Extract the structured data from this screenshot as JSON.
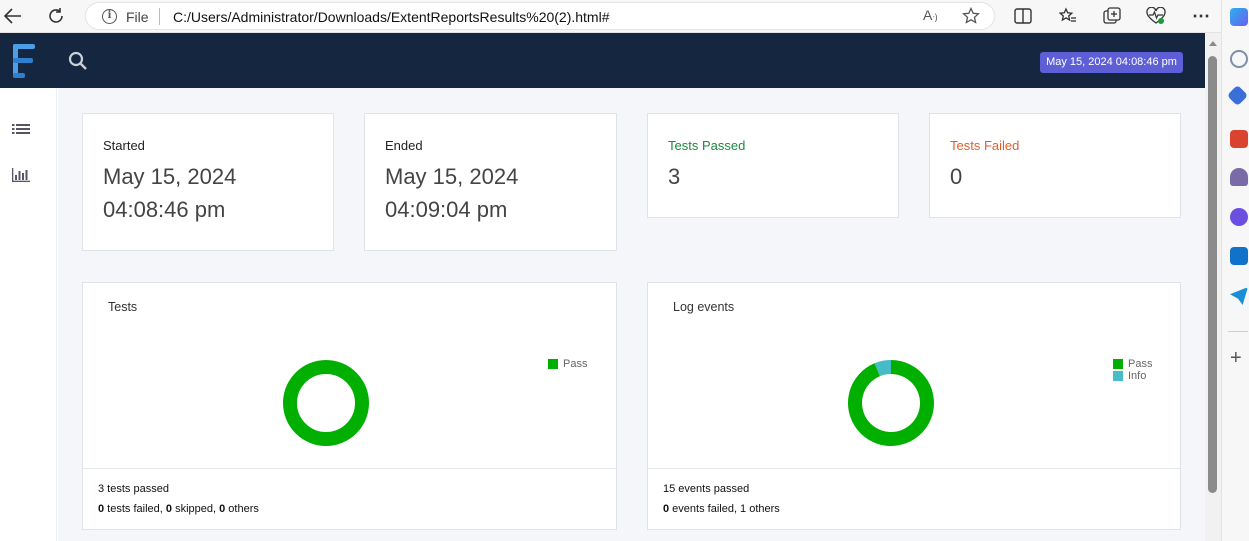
{
  "browser": {
    "file_label": "File",
    "url": "C:/Users/Administrator/Downloads/ExtentReportsResults%20(2).html#"
  },
  "header": {
    "date_badge": "May 15, 2024 04:08:46 pm"
  },
  "cards": {
    "started": {
      "label": "Started",
      "date": "May 15, 2024",
      "time": "04:08:46 pm"
    },
    "ended": {
      "label": "Ended",
      "date": "May 15, 2024",
      "time": "04:09:04 pm"
    },
    "tests_passed": {
      "label": "Tests Passed",
      "value": "3"
    },
    "tests_failed": {
      "label": "Tests Failed",
      "value": "0"
    }
  },
  "tests_chart": {
    "title": "Tests",
    "legend": [
      {
        "label": "Pass",
        "color": "#00af00"
      }
    ],
    "footer_line1": "3 tests passed",
    "footer_failed_count": "0",
    "footer_failed_text": " tests failed, ",
    "footer_skipped_count": "0",
    "footer_skipped_text": " skipped, ",
    "footer_others_count": "0",
    "footer_others_text": " others"
  },
  "log_chart": {
    "title": "Log events",
    "legend": [
      {
        "label": "Pass",
        "color": "#00af00"
      },
      {
        "label": "Info",
        "color": "#46bdc6"
      }
    ],
    "footer_line1": "15 events passed",
    "footer_failed_count": "0",
    "footer_rest": " events failed, 1 others"
  },
  "chart_data": [
    {
      "type": "pie",
      "title": "Tests",
      "categories": [
        "Pass"
      ],
      "values": [
        3
      ],
      "colors": [
        "#00af00"
      ],
      "donut": true,
      "legend": "right"
    },
    {
      "type": "pie",
      "title": "Log events",
      "categories": [
        "Pass",
        "Info"
      ],
      "values": [
        15,
        1
      ],
      "colors": [
        "#00af00",
        "#46bdc6"
      ],
      "donut": true,
      "legend": "right"
    }
  ],
  "icons": {
    "back": "back-arrow-icon",
    "refresh": "refresh-icon",
    "info": "info-icon",
    "read_aloud": "read-aloud-icon",
    "favorite": "star-icon",
    "split": "split-screen-icon",
    "favorites": "favorites-icon",
    "collections": "collections-icon",
    "performance": "heart-pulse-icon",
    "more": "more-icon",
    "search": "search-icon",
    "list": "list-icon",
    "dashboard": "bar-chart-icon"
  }
}
